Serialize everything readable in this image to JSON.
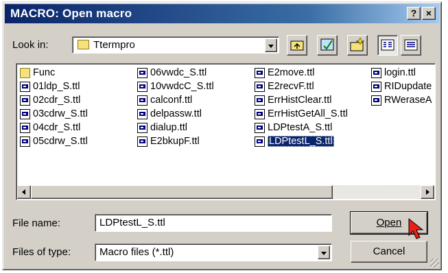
{
  "window": {
    "title": "MACRO: Open macro",
    "help_label": "?",
    "close_label": "×"
  },
  "look_in": {
    "label": "Look in:",
    "label_accel": "i",
    "value": "Ttermpro"
  },
  "toolbar": {
    "up_icon": "up-one-level-icon",
    "desktop_icon": "desktop-icon",
    "new_folder_icon": "new-folder-icon",
    "list_icon": "list-view-icon",
    "details_icon": "details-view-icon"
  },
  "files": {
    "col1": [
      "Func",
      "01ldp_S.ttl",
      "02cdr_S.ttl",
      "03cdrw_S.ttl",
      "04cdr_S.ttl",
      "05cdrw_S.ttl"
    ],
    "col2": [
      "06vwdc_S.ttl",
      "10vwdcC_S.ttl",
      "calconf.ttl",
      "delpassw.ttl",
      "dialup.ttl",
      "E2bkupF.ttl"
    ],
    "col3": [
      "E2move.ttl",
      "E2recvF.ttl",
      "ErrHistClear.ttl",
      "ErrHistGetAll_S.ttl",
      "LDPtestA_S.ttl",
      "LDPtestL_S.ttl"
    ],
    "col4": [
      "login.ttl",
      "RIDupdate",
      "RWeraseA"
    ],
    "selected": "LDPtestL_S.ttl"
  },
  "file_name": {
    "label": "File name:",
    "value": "LDPtestL_S.ttl"
  },
  "file_type": {
    "label": "Files of type:",
    "value": "Macro files (*.ttl)"
  },
  "buttons": {
    "open": "Open",
    "cancel": "Cancel"
  },
  "colors": {
    "title_start": "#0a246a",
    "title_end": "#a6caf0",
    "face": "#d4d0c8",
    "selection": "#0a246a",
    "cursor": "#e8201a"
  }
}
